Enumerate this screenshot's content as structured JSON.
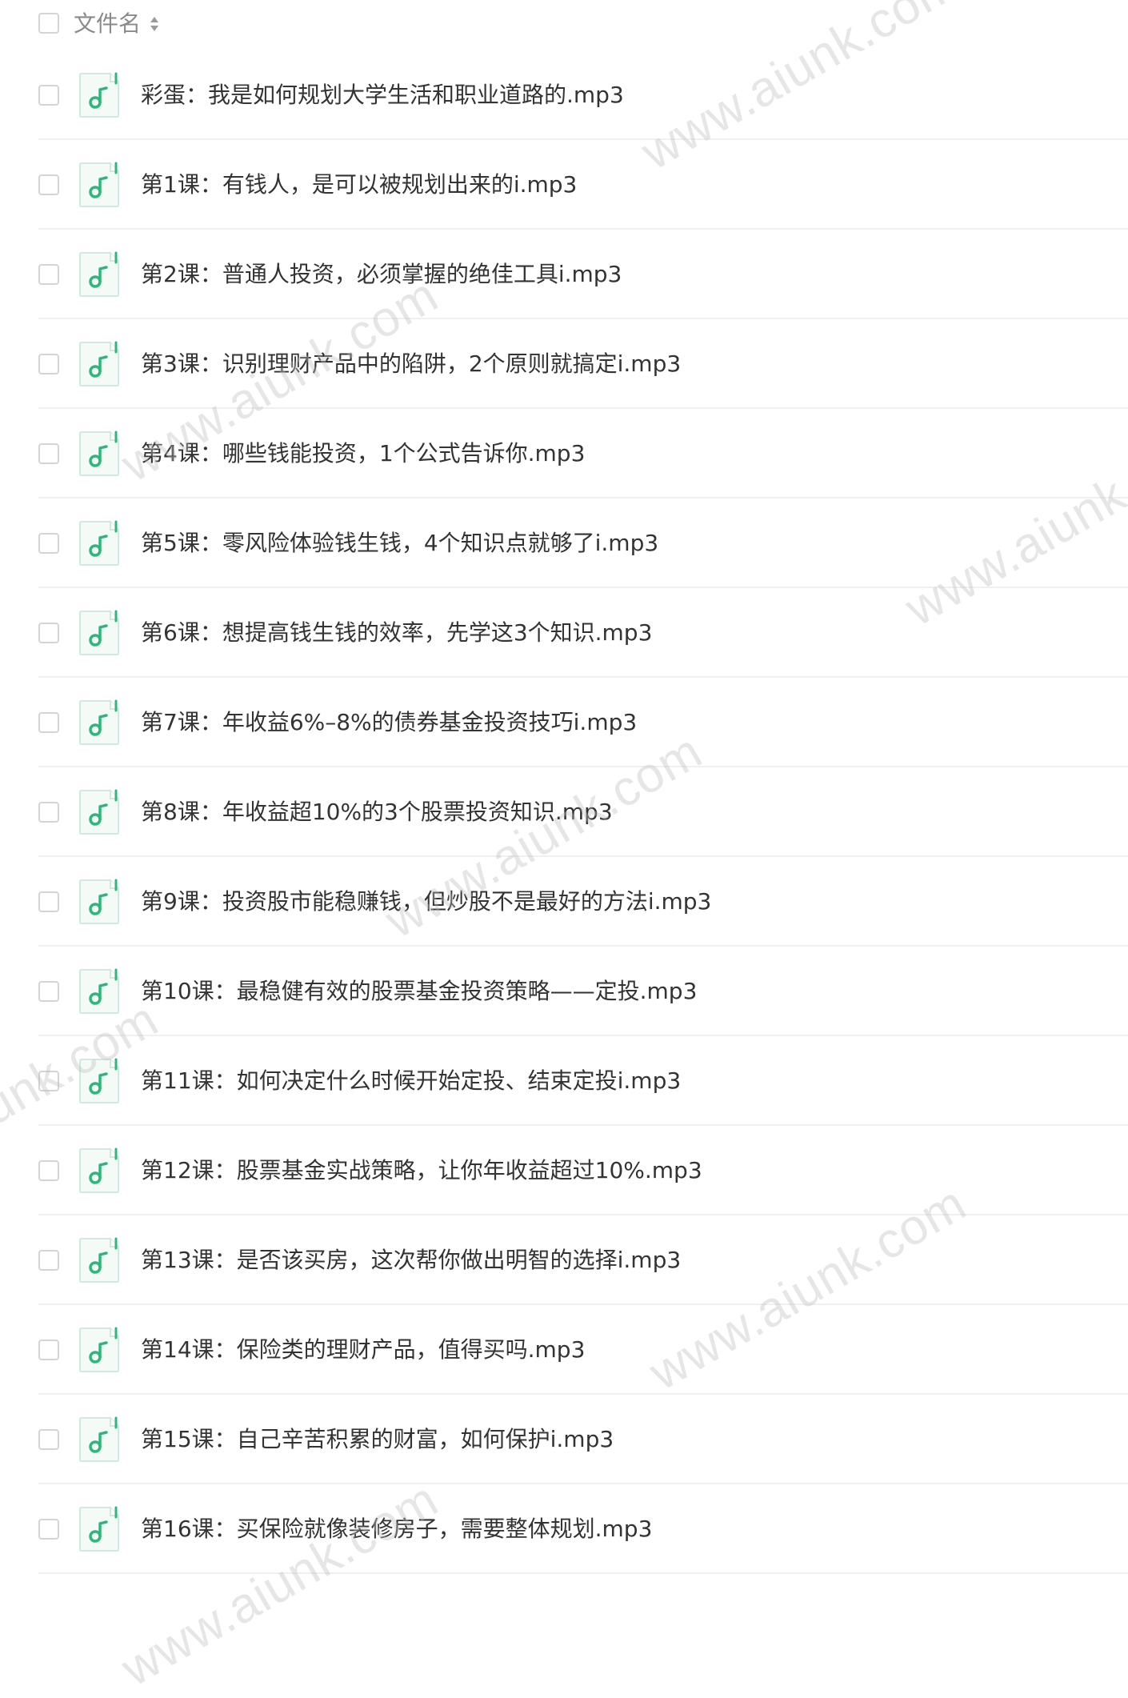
{
  "header": {
    "column_label": "文件名"
  },
  "icons": {
    "file_icon": "music-file-icon",
    "sort_icon": "sort-icon",
    "accent_color": "#2eb67d"
  },
  "files": [
    {
      "name": "彩蛋：我是如何规划大学生活和职业道路的.mp3"
    },
    {
      "name": "第1课：有钱人，是可以被规划出来的i.mp3"
    },
    {
      "name": "第2课：普通人投资，必须掌握的绝佳工具i.mp3"
    },
    {
      "name": "第3课：识别理财产品中的陷阱，2个原则就搞定i.mp3"
    },
    {
      "name": "第4课：哪些钱能投资，1个公式告诉你.mp3"
    },
    {
      "name": "第5课：零风险体验钱生钱，4个知识点就够了i.mp3"
    },
    {
      "name": "第6课：想提高钱生钱的效率，先学这3个知识.mp3"
    },
    {
      "name": "第7课：年收益6%–8%的债券基金投资技巧i.mp3"
    },
    {
      "name": "第8课：年收益超10%的3个股票投资知识.mp3"
    },
    {
      "name": "第9课：投资股市能稳赚钱，但炒股不是最好的方法i.mp3"
    },
    {
      "name": "第10课：最稳健有效的股票基金投资策略——定投.mp3"
    },
    {
      "name": "第11课：如何决定什么时候开始定投、结束定投i.mp3"
    },
    {
      "name": "第12课：股票基金实战策略，让你年收益超过10%.mp3"
    },
    {
      "name": "第13课：是否该买房，这次帮你做出明智的选择i.mp3"
    },
    {
      "name": "第14课：保险类的理财产品，值得买吗.mp3"
    },
    {
      "name": "第15课：自己辛苦积累的财富，如何保护i.mp3"
    },
    {
      "name": "第16课：买保险就像装修房子，需要整体规划.mp3"
    }
  ],
  "watermarks": [
    {
      "text": "www.aiunk.com"
    },
    {
      "text": "www.aiunk.com"
    },
    {
      "text": "www.aiunk.com"
    },
    {
      "text": "www.aiunk.com"
    },
    {
      "text": "www.aiunk.com"
    },
    {
      "text": "www.aiunk.com"
    },
    {
      "text": "www.aiunk.com"
    }
  ]
}
